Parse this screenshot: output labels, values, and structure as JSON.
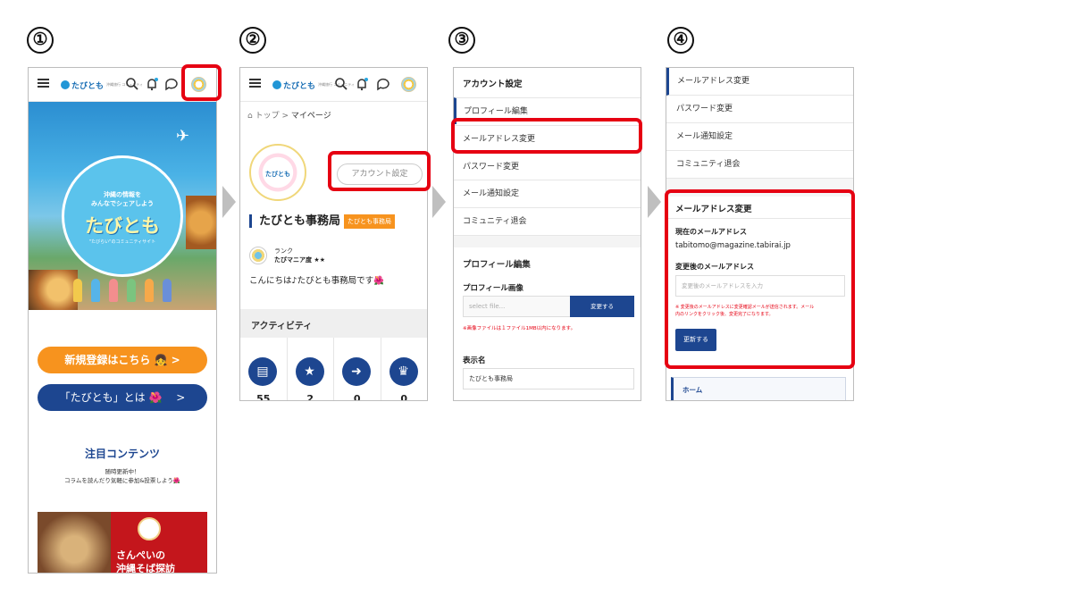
{
  "steps": [
    "①",
    "②",
    "③",
    "④"
  ],
  "header": {
    "logo": "たびとも",
    "logo_sub": "沖縄旅行 コミュニティ"
  },
  "frame1": {
    "hero_line1": "沖縄の情報を",
    "hero_line2": "みんなでシェアしよう",
    "hero_title": "たびとも",
    "hero_sub": "\"たびらい\"のコミュニティサイト",
    "register_button": "新規登録はこちら 👧 >",
    "about_button": "「たびとも」とは 🌺　 >",
    "featured_title": "注目コンテンツ",
    "featured_sub1": "随時更新中！",
    "featured_sub2": "コラムを読んだり気軽に参加&投票しよう🌺",
    "thumb_text1": "さんぺいの",
    "thumb_text2": "沖縄そば探訪"
  },
  "frame2": {
    "breadcrumb_home": "トップ",
    "breadcrumb_sep": ">",
    "breadcrumb_current": "マイページ",
    "avatar_text": "たびとも",
    "account_settings_button": "アカウント設定",
    "user_name": "たびとも事務局",
    "user_badge": "たびとも事務局",
    "rank_label": "ランク",
    "rank_value": "たびマニア度 ★★",
    "greeting": "こんにちは♪たびとも事務局です🌺",
    "activity_title": "アクティビティ",
    "activity": [
      {
        "icon": "▤",
        "value": "55"
      },
      {
        "icon": "★",
        "value": "2"
      },
      {
        "icon": "➜",
        "value": "0"
      },
      {
        "icon": "♛",
        "value": "0"
      }
    ]
  },
  "frame3": {
    "title": "アカウント設定",
    "menu": [
      "プロフィール編集",
      "メールアドレス変更",
      "パスワード変更",
      "メール通知設定",
      "コミュニティ退会"
    ],
    "section_title": "プロフィール編集",
    "image_label": "プロフィール画像",
    "file_placeholder": "select file...",
    "change_button": "変更する",
    "image_note": "※画像ファイルは１ファイル1MB以内になります。",
    "display_name_label": "表示名",
    "display_name_value": "たびとも事務局"
  },
  "frame4": {
    "menu": [
      "メールアドレス変更",
      "パスワード変更",
      "メール通知設定",
      "コミュニティ退会"
    ],
    "section_title": "メールアドレス変更",
    "current_label": "現在のメールアドレス",
    "current_value": "tabitomo@magazine.tabirai.jp",
    "new_label": "変更後のメールアドレス",
    "new_placeholder": "変更後のメールアドレスを入力",
    "note1": "※ 変更後のメールアドレスに変更確認メールが送信されます。メール",
    "note2": "内のリンクをクリック後、変更完了になります。",
    "update_button": "更新する",
    "home_link": "ホーム"
  }
}
